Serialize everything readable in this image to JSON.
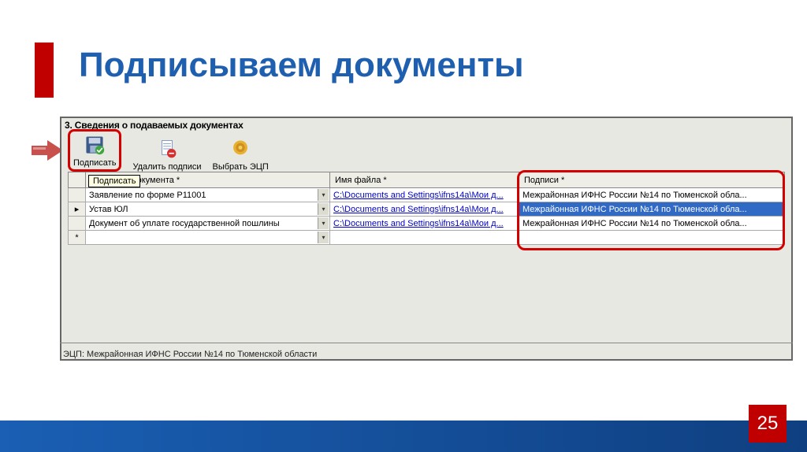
{
  "title": "Подписываем документы",
  "section_heading": "3. Сведения о подаваемых документах",
  "toolbar": {
    "sign": "Подписать",
    "delete_sign": "Удалить подписи",
    "select_ecp": "Выбрать ЭЦП"
  },
  "tooltip": "Подписать",
  "table": {
    "headers": {
      "name": "Название документа *",
      "file": "Имя файла *",
      "sign": "Подписи *"
    },
    "rows": [
      {
        "indicator": "",
        "name": "Заявление по форме Р11001",
        "file": "C:\\Documents and Settings\\ifns14a\\Мои д...",
        "sign": "Межрайонная ИФНС России №14 по Тюменской обла...",
        "selected": false
      },
      {
        "indicator": "▸",
        "name": "Устав ЮЛ",
        "file": "C:\\Documents and Settings\\ifns14a\\Мои д...",
        "sign": "Межрайонная ИФНС России №14 по Тюменской обла...",
        "selected": true
      },
      {
        "indicator": "",
        "name": "Документ об уплате государственной пошлины",
        "file": "C:\\Documents and Settings\\ifns14a\\Мои д...",
        "sign": "Межрайонная ИФНС России №14 по Тюменской обла...",
        "selected": false
      },
      {
        "indicator": "*",
        "name": "",
        "file": "",
        "sign": "",
        "selected": false
      }
    ]
  },
  "footer_status": "ЭЦП: Межрайонная ИФНС России №14 по Тюменской области",
  "page_number": "25"
}
